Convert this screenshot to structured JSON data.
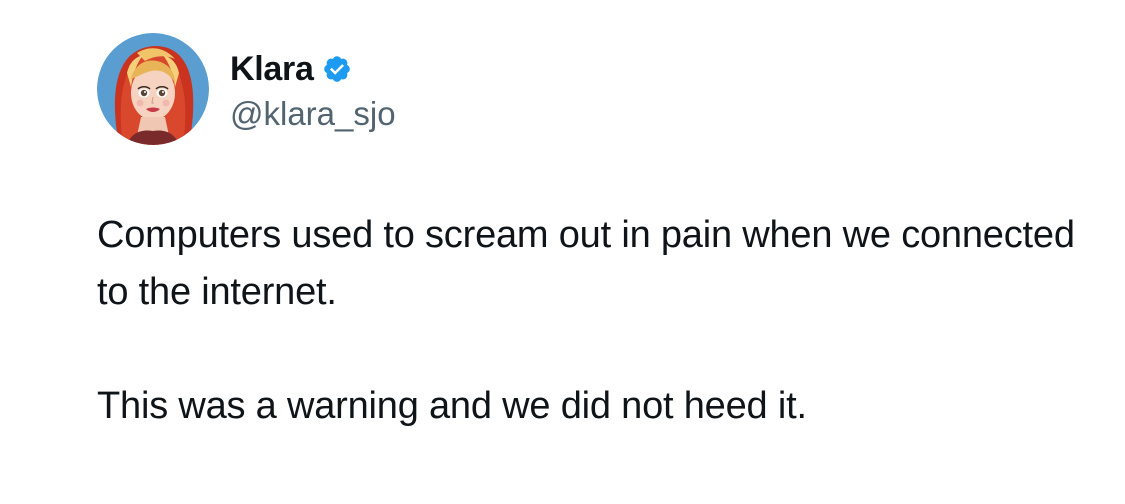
{
  "author": {
    "display_name": "Klara",
    "handle": "@klara_sjo",
    "verified": true,
    "verified_icon": "verified-badge-icon",
    "verified_color": "#1d9bf0",
    "avatar": "cartoon-portrait-avatar"
  },
  "tweet": {
    "paragraphs": [
      "Computers used to scream out in pain when we connected to the internet.",
      "This was a warning and we did not heed it."
    ]
  },
  "colors": {
    "text": "#0f1419",
    "secondary_text": "#536471",
    "background": "#ffffff"
  }
}
